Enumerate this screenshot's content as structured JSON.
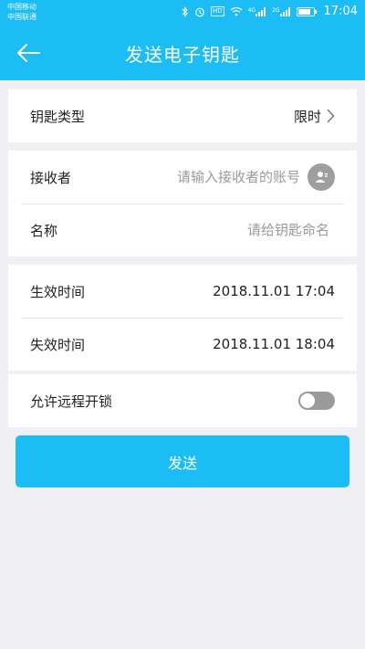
{
  "status_bar": {
    "carrier_1": "中国移动",
    "carrier_2": "中国联通",
    "hd_badge": "HD",
    "signal_1_label": "4G",
    "signal_2_label": "2G",
    "time": "17:04",
    "battery_level": 0.85,
    "icons": [
      "bluetooth-icon",
      "alarm-icon",
      "wifi-icon",
      "signal-icon",
      "battery-icon"
    ]
  },
  "header": {
    "title": "发送电子钥匙",
    "back_icon": "arrow-left-icon"
  },
  "key_type": {
    "label": "钥匙类型",
    "value": "限时"
  },
  "receiver": {
    "label": "接收者",
    "placeholder": "请输入接收者的账号",
    "value": ""
  },
  "name": {
    "label": "名称",
    "placeholder": "请给钥匙命名",
    "value": ""
  },
  "effective_time": {
    "label": "生效时间",
    "value": "2018.11.01 17:04"
  },
  "expire_time": {
    "label": "失效时间",
    "value": "2018.11.01 18:04"
  },
  "remote_unlock": {
    "label": "允许远程开锁",
    "enabled": false
  },
  "send_button": {
    "label": "发送"
  },
  "colors": {
    "primary": "#1cbcf4",
    "background": "#efeff4",
    "toggle_off": "#9a9a9a"
  }
}
